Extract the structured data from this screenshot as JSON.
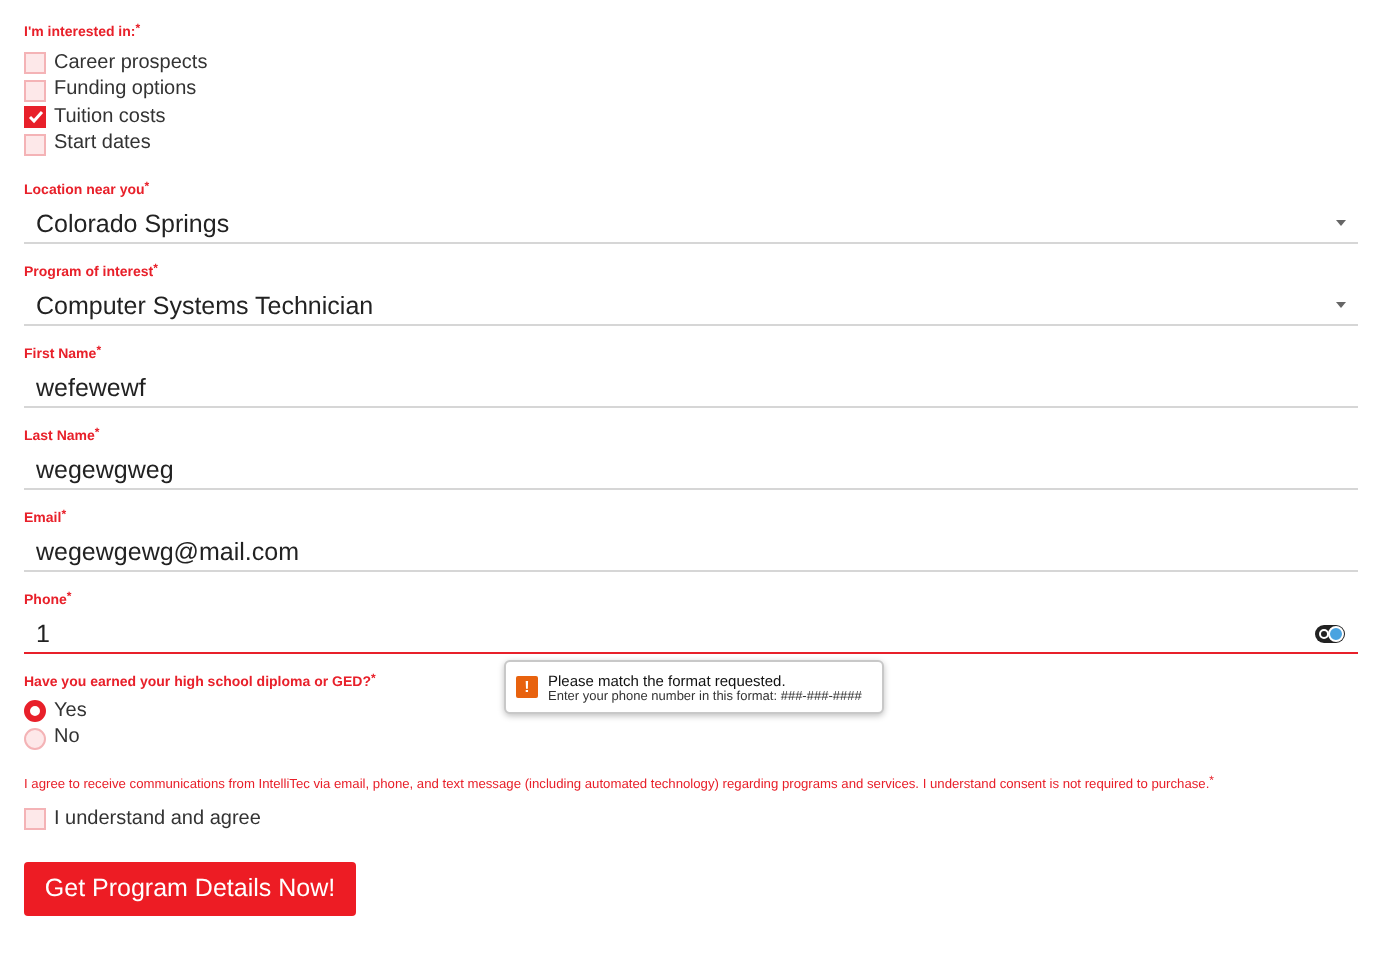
{
  "interests": {
    "label": "I'm interested in:$^{*}$",
    "options": [
      {
        "label": "Career prospects",
        "checked": false
      },
      {
        "label": "Funding options",
        "checked": false
      },
      {
        "label": "Tuition costs",
        "checked": true
      },
      {
        "label": "Start dates",
        "checked": false
      }
    ]
  },
  "fields": [
    {
      "kind": "select",
      "label": "Location near you$^{*}$",
      "value": "Colorado Springs",
      "invalid": false
    },
    {
      "kind": "select",
      "label": "Program of interest$^{*}$",
      "value": "Computer Systems Technician",
      "invalid": false
    },
    {
      "kind": "text",
      "label": "First Name$^{*}$",
      "value": "wefewewf",
      "invalid": false
    },
    {
      "kind": "text",
      "label": "Last Name$^{*}$",
      "value": "wegewgweg",
      "invalid": false
    },
    {
      "kind": "text",
      "label": "Email$^{*}$",
      "value": "wegewgewg@mail.com",
      "invalid": false
    },
    {
      "kind": "phone",
      "label": "Phone$^{*}$",
      "value": "1",
      "invalid": true
    }
  ],
  "tooltip": {
    "icon": "!",
    "title": "Please match the format requested.",
    "message": "Enter your phone number in this format: ###-###-####"
  },
  "diploma": {
    "label": "Have you earned your high school diploma or GED?$^{*}$",
    "options": [
      {
        "label": "Yes",
        "selected": true
      },
      {
        "label": "No",
        "selected": false
      }
    ]
  },
  "consent": {
    "text": "I agree to receive communications from IntelliTec via email, phone, and text message (including automated technology) regarding programs and services. I understand consent is not required to purchase.$^{*}$",
    "checkbox": {
      "label": "I understand and agree",
      "checked": false
    }
  },
  "submit": {
    "label": "Get Program Details Now!"
  }
}
